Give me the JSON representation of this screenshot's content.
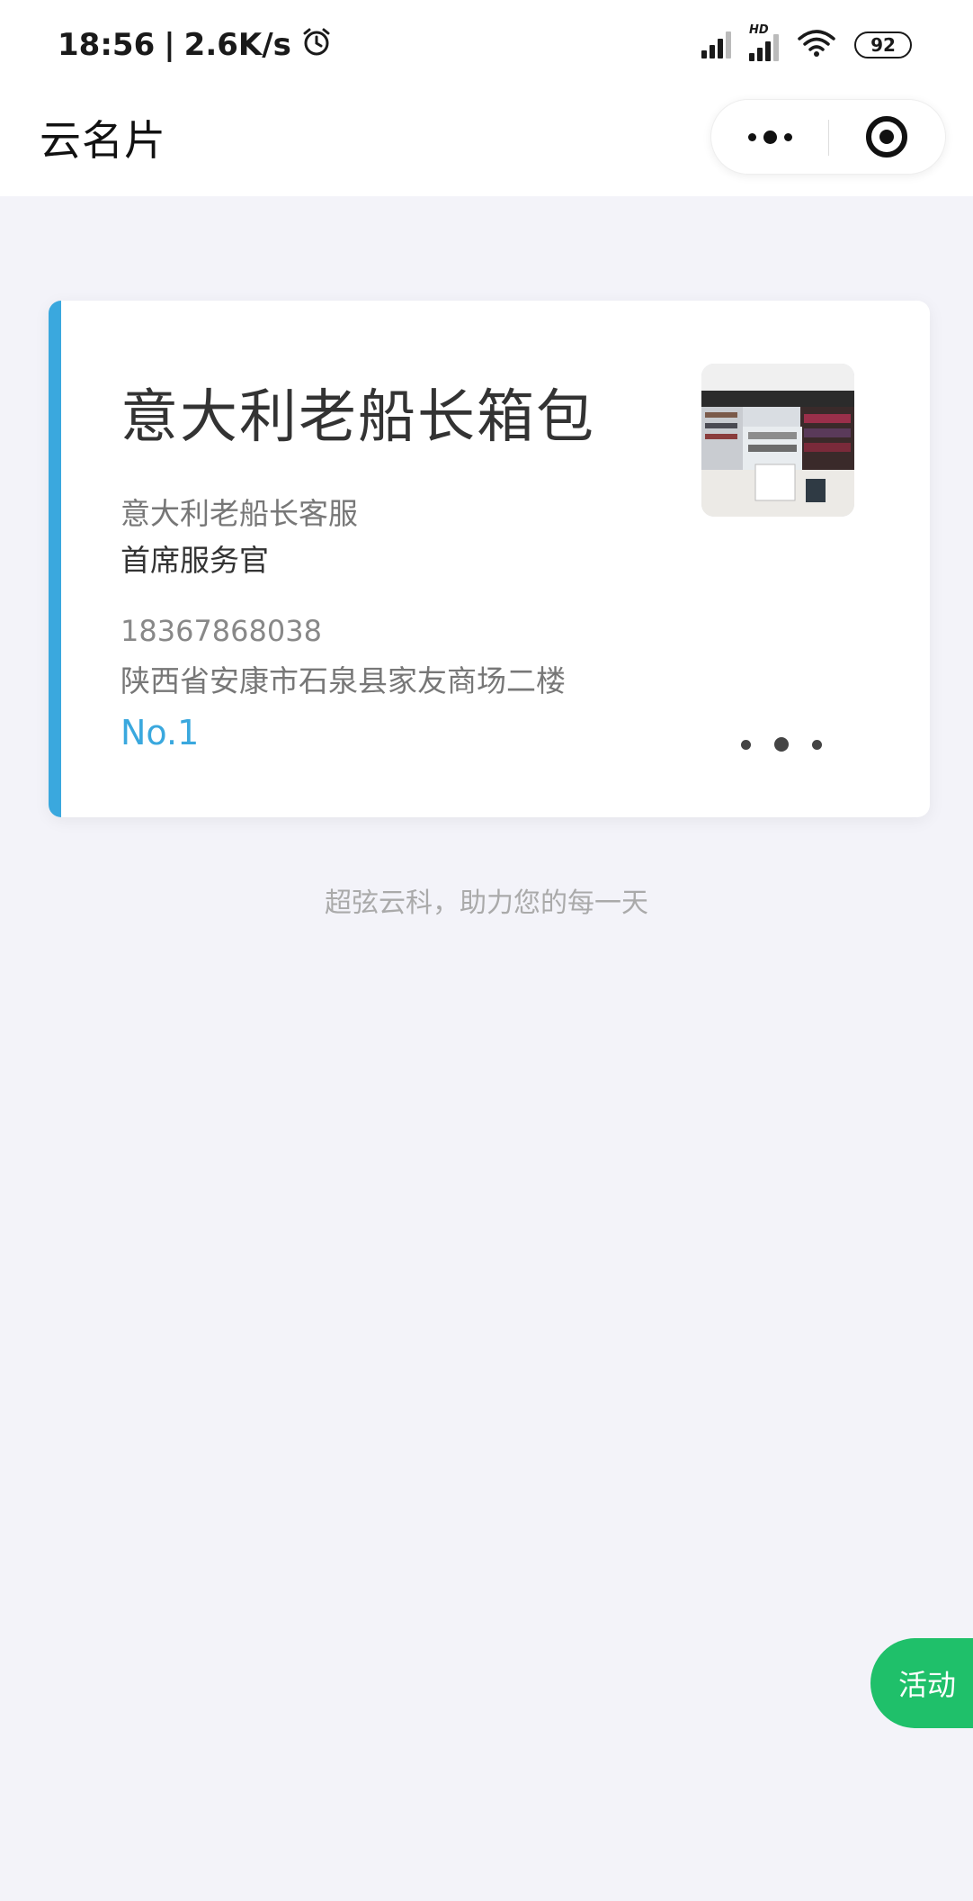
{
  "status_bar": {
    "time": "18:56",
    "separator": "|",
    "network_speed": "2.6K/s",
    "alarm_icon": "alarm-clock-icon",
    "hd_label": "HD",
    "battery": "92"
  },
  "nav": {
    "title": "云名片",
    "more_icon": "more-dots-icon",
    "close_icon": "target-close-icon"
  },
  "card": {
    "accent_color": "#3aa8de",
    "company": "意大利老船长箱包",
    "person_name": "意大利老船长客服",
    "person_title": "首席服务官",
    "phone": "18367868038",
    "address": "陕西省安康市石泉县家友商场二楼",
    "rank": "No.1",
    "photo_icon": "store-photo"
  },
  "footer": {
    "slogan": "超弦云科，助力您的每一天"
  },
  "floating": {
    "activity_label": "活动",
    "color": "#1fc06a"
  }
}
